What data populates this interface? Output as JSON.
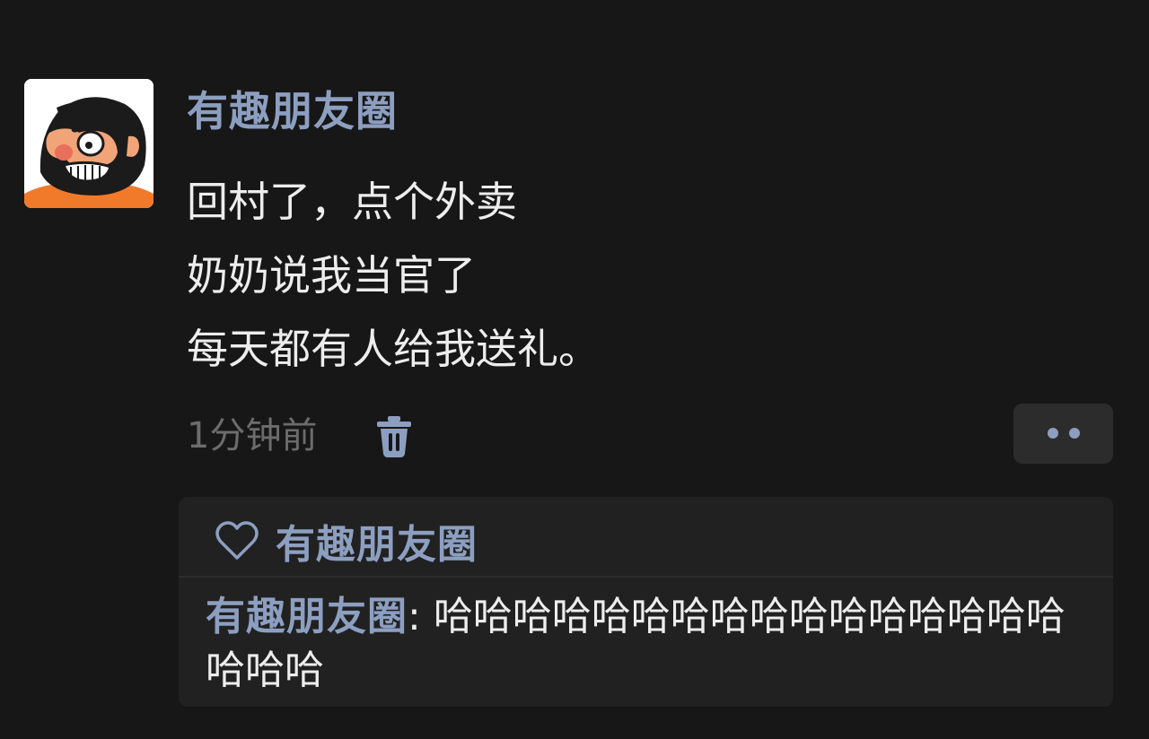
{
  "post": {
    "author": "有趣朋友圈",
    "lines": [
      "回村了，点个外卖",
      "奶奶说我当官了",
      "每天都有人给我送礼。"
    ],
    "timestamp": "1分钟前"
  },
  "icons": {
    "avatar": "cartoon-bearded-man-avatar",
    "delete": "trash-icon",
    "more": "two-dots-icon",
    "like": "heart-outline-icon"
  },
  "likes": {
    "names": "有趣朋友圈"
  },
  "comments": [
    {
      "author": "有趣朋友圈",
      "separator": ": ",
      "text": "哈哈哈哈哈哈哈哈哈哈哈哈哈哈哈哈哈哈哈"
    }
  ],
  "colors": {
    "background": "#171717",
    "name_blue": "#8d9fc0",
    "text": "#ededed",
    "muted": "#6c6c6c",
    "panel": "#212121",
    "button": "#2c2c2c"
  }
}
